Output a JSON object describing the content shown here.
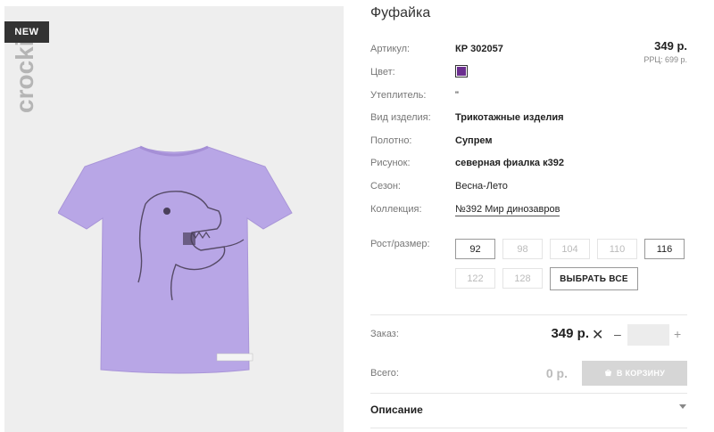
{
  "badge": "NEW",
  "brand": "crockid",
  "product": {
    "title": "Фуфайка",
    "price": "349 р.",
    "rrp": "РРЦ: 699 р.",
    "color_hex": "#6b2e8f"
  },
  "attributes": [
    {
      "label": "Артикул:",
      "value": "КР 302057"
    },
    {
      "label": "Цвет:",
      "value": ""
    },
    {
      "label": "Утеплитель:",
      "value": "\""
    },
    {
      "label": "Вид изделия:",
      "value": "Трикотажные изделия"
    },
    {
      "label": "Полотно:",
      "value": "Супрем"
    },
    {
      "label": "Рисунок:",
      "value": "северная фиалка к392"
    },
    {
      "label": "Сезон:",
      "value": "Весна-Лето"
    },
    {
      "label": "Коллекция:",
      "value": "№392 Мир динозавров"
    }
  ],
  "sizes": {
    "label": "Рост/размер:",
    "options": [
      {
        "label": "92",
        "available": true
      },
      {
        "label": "98",
        "available": false
      },
      {
        "label": "104",
        "available": false
      },
      {
        "label": "110",
        "available": false
      },
      {
        "label": "116",
        "available": true
      },
      {
        "label": "122",
        "available": false
      },
      {
        "label": "128",
        "available": false
      }
    ],
    "select_all": "ВЫБРАТЬ ВСЕ"
  },
  "order": {
    "label": "Заказ:",
    "price": "349 р.",
    "times": "✕",
    "minus": "–",
    "plus": "+",
    "quantity": ""
  },
  "total": {
    "label": "Всего:",
    "value": "0 р.",
    "cart_button": "В КОРЗИНУ"
  },
  "description": {
    "label": "Описание"
  },
  "colors": {
    "accent": "#6b2e8f",
    "shirt": "#b8a6e6",
    "badge_bg": "#333333",
    "cart_bg": "#d6d6d6"
  }
}
